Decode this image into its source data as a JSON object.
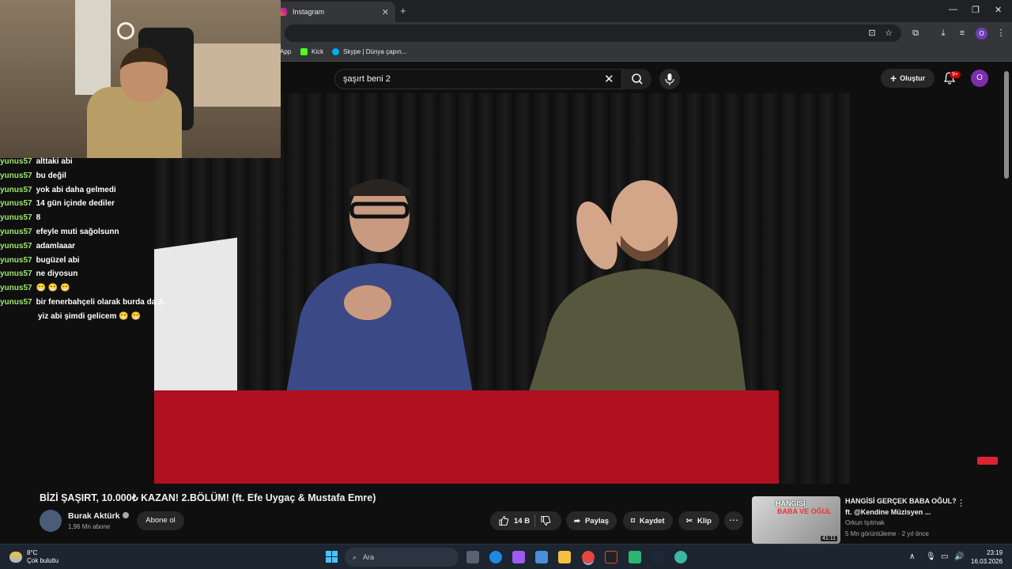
{
  "browser": {
    "tab_title": "Instagram",
    "bookmarks": [
      "App",
      "Kick",
      "Skype | Dünya çapın..."
    ],
    "profile_initial": "O"
  },
  "youtube": {
    "search_query": "şaşırt beni 2",
    "create_label": "Oluştur",
    "notification_badge": "9+",
    "avatar_initial": "O"
  },
  "chat": {
    "messages": [
      {
        "user": "yunus57",
        "text": "alttaki abi"
      },
      {
        "user": "yunus57",
        "text": "bu değil"
      },
      {
        "user": "yunus57",
        "text": "yok abi daha gelmedi"
      },
      {
        "user": "yunus57",
        "text": "14 gün içinde dediler"
      },
      {
        "user": "yunus57",
        "text": "8"
      },
      {
        "user": "yunus57",
        "text": "efeyle muti sağolsunn"
      },
      {
        "user": "yunus57",
        "text": "adamlaaar"
      },
      {
        "user": "yunus57",
        "text": "bugüzel abi"
      },
      {
        "user": "yunus57",
        "text": "ne diyosun"
      },
      {
        "user": "yunus57",
        "text": "😁 😁 😁"
      },
      {
        "user": "yunus57",
        "text": "bir fenerbahçeli olarak burda da 2.",
        "cont": "yiz abi şimdi gelicem 😁 😁"
      }
    ]
  },
  "video": {
    "title": "BİZİ ŞAŞIRT, 10.000₺ KAZAN! 2.BÖLÜM! (ft. Efe Uygaç & Mustafa Emre)",
    "channel": "Burak Aktürk",
    "subscribers": "1,96 Mn abone",
    "subscribe_label": "Abone ol",
    "likes": "14 B",
    "share_label": "Paylaş",
    "save_label": "Kaydet",
    "clip_label": "Klip"
  },
  "recommended": {
    "thumb_line1": "HANGİSİ",
    "thumb_line2": "BABA VE OĞUL",
    "duration": "41:11",
    "title": "HANGİSİ GERÇEK BABA OĞUL?",
    "subtitle": "ft. @Kendine Müzisyen ...",
    "channel": "Orkun Işıtmak",
    "meta": "5 Mn görüntüleme · 2 yıl önce"
  },
  "taskbar": {
    "temperature": "8°C",
    "weather": "Çok bulutlu",
    "search_placeholder": "Ara",
    "time": "23:19",
    "date": "16.03.2026"
  }
}
